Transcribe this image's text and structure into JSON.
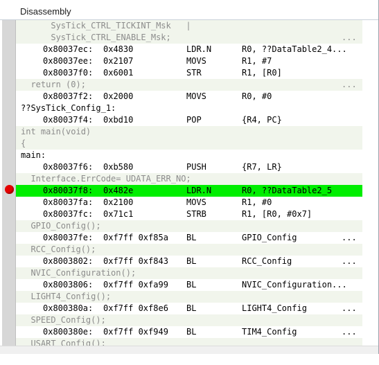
{
  "window": {
    "title": "Disassembly"
  },
  "lines": [
    {
      "kind": "src",
      "text": "      SysTick_CTRL_TICKINT_Msk   |",
      "more": ""
    },
    {
      "kind": "src",
      "text": "      SysTick_CTRL_ENABLE_Msk;",
      "more": "..."
    },
    {
      "kind": "asm",
      "addr": "0x80037ec:",
      "code": "0x4830",
      "mnem": "LDR.N",
      "ops": "R0, ??DataTable2_4..."
    },
    {
      "kind": "asm",
      "addr": "0x80037ee:",
      "code": "0x2107",
      "mnem": "MOVS",
      "ops": "R1, #7"
    },
    {
      "kind": "asm",
      "addr": "0x80037f0:",
      "code": "0x6001",
      "mnem": "STR",
      "ops": "R1, [R0]"
    },
    {
      "kind": "src",
      "text": "  return (0);",
      "more": "..."
    },
    {
      "kind": "asm",
      "addr": "0x80037f2:",
      "code": "0x2000",
      "mnem": "MOVS",
      "ops": "R0, #0"
    },
    {
      "kind": "label",
      "text": "??SysTick_Config_1:"
    },
    {
      "kind": "asm",
      "addr": "0x80037f4:",
      "code": "0xbd10",
      "mnem": "POP",
      "ops": "{R4, PC}"
    },
    {
      "kind": "src",
      "text": "int main(void)",
      "more": ""
    },
    {
      "kind": "src",
      "text": "{",
      "more": ""
    },
    {
      "kind": "label",
      "text": "main:"
    },
    {
      "kind": "asm",
      "addr": "0x80037f6:",
      "code": "0xb580",
      "mnem": "PUSH",
      "ops": "{R7, LR}"
    },
    {
      "kind": "src",
      "text": "  Interface.ErrCode= UDATA_ERR_NO;",
      "more": ""
    },
    {
      "kind": "asm",
      "highlight": true,
      "addr": "0x80037f8:",
      "code": "0x482e",
      "mnem": "LDR.N",
      "ops": "R0, ??DataTable2_5"
    },
    {
      "kind": "asm",
      "addr": "0x80037fa:",
      "code": "0x2100",
      "mnem": "MOVS",
      "ops": "R1, #0"
    },
    {
      "kind": "asm",
      "addr": "0x80037fc:",
      "code": "0x71c1",
      "mnem": "STRB",
      "ops": "R1, [R0, #0x7]"
    },
    {
      "kind": "src",
      "text": "  GPIO_Config();",
      "more": ""
    },
    {
      "kind": "asm",
      "addr": "0x80037fe:",
      "code": "0xf7ff 0xf85a",
      "mnem": "BL",
      "ops": "GPIO_Config",
      "more": "..."
    },
    {
      "kind": "src",
      "text": "  RCC_Config();",
      "more": ""
    },
    {
      "kind": "asm",
      "addr": "0x8003802:",
      "code": "0xf7ff 0xf843",
      "mnem": "BL",
      "ops": "RCC_Config",
      "more": "..."
    },
    {
      "kind": "src",
      "text": "  NVIC_Configuration();",
      "more": ""
    },
    {
      "kind": "asm",
      "addr": "0x8003806:",
      "code": "0xf7ff 0xfa99",
      "mnem": "BL",
      "ops": "NVIC_Configuration..."
    },
    {
      "kind": "src",
      "text": "  LIGHT4_Config();",
      "more": ""
    },
    {
      "kind": "asm",
      "addr": "0x800380a:",
      "code": "0xf7ff 0xf8e6",
      "mnem": "BL",
      "ops": "LIGHT4_Config",
      "more": "..."
    },
    {
      "kind": "src",
      "text": "  SPEED_Config();",
      "more": ""
    },
    {
      "kind": "asm",
      "addr": "0x800380e:",
      "code": "0xf7ff 0xf949",
      "mnem": "BL",
      "ops": "TIM4_Config",
      "more": "..."
    },
    {
      "kind": "src",
      "text": "  USART_Config();",
      "more": ""
    }
  ],
  "colors": {
    "highlight": "#00ee00",
    "source_bg": "#f1f5ec",
    "source_text": "#8c8c8c",
    "breakpoint": "#e40000"
  },
  "icons": {
    "breakpoint": "breakpoint-icon"
  }
}
